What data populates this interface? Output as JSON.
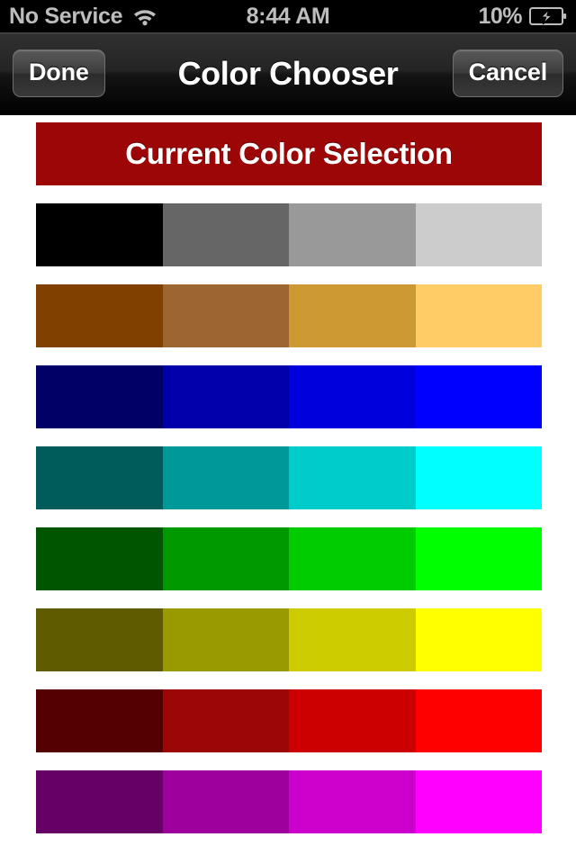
{
  "status_bar": {
    "carrier": "No Service",
    "wifi_icon": "wifi-icon",
    "time": "8:44 AM",
    "battery_percent": "10%",
    "battery_icon": "battery-charging-icon"
  },
  "nav_bar": {
    "done_label": "Done",
    "title": "Color Chooser",
    "cancel_label": "Cancel"
  },
  "current_color": {
    "label": "Current Color Selection",
    "hex": "#9D0606"
  },
  "palette": {
    "rows": [
      {
        "name": "grayscale",
        "swatches": [
          {
            "hex": "#000000"
          },
          {
            "hex": "#666666"
          },
          {
            "hex": "#999999"
          },
          {
            "hex": "#CCCCCC"
          }
        ]
      },
      {
        "name": "brown",
        "swatches": [
          {
            "hex": "#804000"
          },
          {
            "hex": "#9C6633"
          },
          {
            "hex": "#CC9933"
          },
          {
            "hex": "#FFCC66"
          }
        ]
      },
      {
        "name": "blue",
        "swatches": [
          {
            "hex": "#000066"
          },
          {
            "hex": "#0000AA"
          },
          {
            "hex": "#0000DD"
          },
          {
            "hex": "#0000FF"
          }
        ]
      },
      {
        "name": "cyan",
        "swatches": [
          {
            "hex": "#005B5B"
          },
          {
            "hex": "#009999"
          },
          {
            "hex": "#00CCCC"
          },
          {
            "hex": "#00FFFF"
          }
        ]
      },
      {
        "name": "green",
        "swatches": [
          {
            "hex": "#005500"
          },
          {
            "hex": "#009900"
          },
          {
            "hex": "#00CC00"
          },
          {
            "hex": "#00FF00"
          }
        ]
      },
      {
        "name": "yellow",
        "swatches": [
          {
            "hex": "#5F5B00"
          },
          {
            "hex": "#999900"
          },
          {
            "hex": "#CCCC00"
          },
          {
            "hex": "#FFFF00"
          }
        ]
      },
      {
        "name": "red",
        "swatches": [
          {
            "hex": "#550000"
          },
          {
            "hex": "#9D0606"
          },
          {
            "hex": "#CC0000"
          },
          {
            "hex": "#FF0000"
          }
        ]
      },
      {
        "name": "magenta",
        "swatches": [
          {
            "hex": "#660066"
          },
          {
            "hex": "#9D009D"
          },
          {
            "hex": "#CC00CC"
          },
          {
            "hex": "#FF00FF"
          }
        ]
      }
    ]
  }
}
